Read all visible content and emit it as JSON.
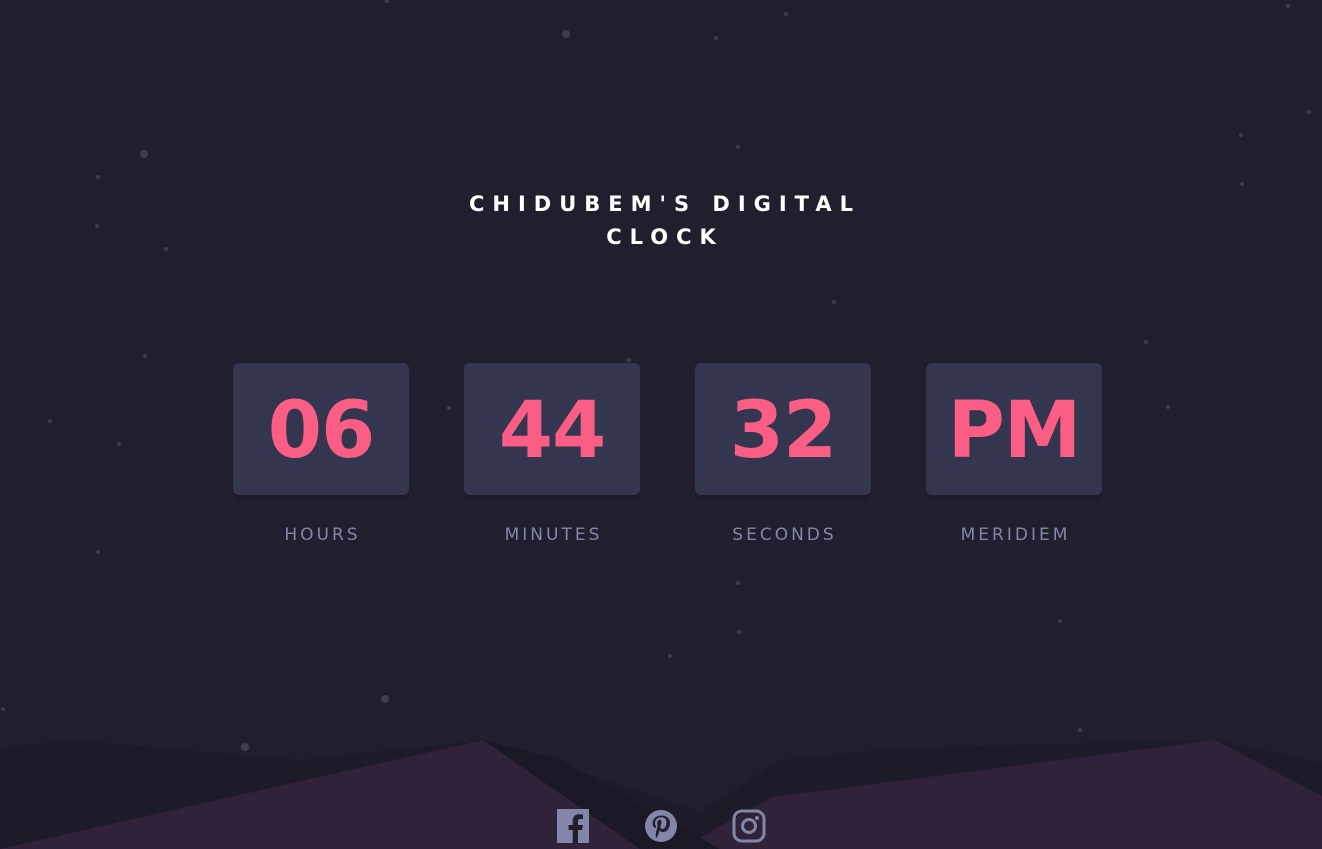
{
  "title": {
    "line1": "CHIDUBEM'S DIGITAL",
    "line2": "CLOCK"
  },
  "clock": {
    "hours": {
      "value": "06",
      "label": "HOURS"
    },
    "minutes": {
      "value": "44",
      "label": "MINUTES"
    },
    "seconds": {
      "value": "32",
      "label": "SECONDS"
    },
    "meridiem": {
      "value": "PM",
      "label": "MERIDIEM"
    }
  },
  "colors": {
    "background": "#211f2d",
    "card": "#343650",
    "digits": "#fb5e84",
    "label": "#8486a9",
    "hill": "#2f2239",
    "icon": "#8486a9"
  },
  "social": {
    "icons": [
      "facebook-icon",
      "pinterest-icon",
      "instagram-icon"
    ]
  }
}
